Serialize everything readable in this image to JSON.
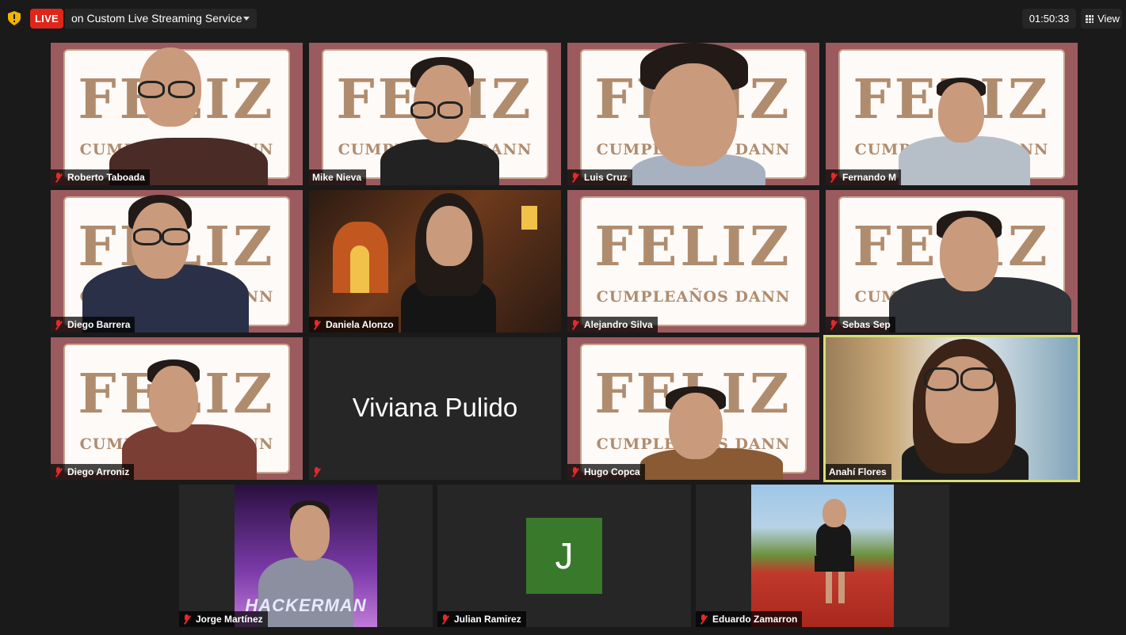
{
  "toolbar": {
    "live_label": "LIVE",
    "stream_label": "on Custom Live Streaming Service",
    "timer": "01:50:33",
    "view_label": "View"
  },
  "background": {
    "title": "FELIZ",
    "subtitle": "CUMPLEAÑOS DANN"
  },
  "participants": [
    {
      "name": "Roberto Taboada",
      "muted": true
    },
    {
      "name": "Mike Nieva",
      "muted": false
    },
    {
      "name": "Luis Cruz",
      "muted": true
    },
    {
      "name": "Fernando M",
      "muted": true
    },
    {
      "name": "Diego Barrera",
      "muted": true
    },
    {
      "name": "Daniela Alonzo",
      "muted": true
    },
    {
      "name": "Alejandro Silva",
      "muted": true
    },
    {
      "name": "Sebas Sep",
      "muted": true
    },
    {
      "name": "Diego Arroniz",
      "muted": true
    },
    {
      "name": "Viviana Pulido",
      "muted": true,
      "video_off": true
    },
    {
      "name": "Hugo Copca",
      "muted": true
    },
    {
      "name": "Anahí Flores",
      "muted": false,
      "active_speaker": true
    },
    {
      "name": "Jorge Martínez",
      "muted": true
    },
    {
      "name": "Julian Ramirez",
      "muted": true,
      "video_off": true,
      "avatar_letter": "J"
    },
    {
      "name": "Eduardo Zamarron",
      "muted": true
    }
  ],
  "colors": {
    "live": "#e0251b",
    "active_border": "#d9de74",
    "avatar": "#39792c",
    "muted_icon": "#e32a2a"
  }
}
